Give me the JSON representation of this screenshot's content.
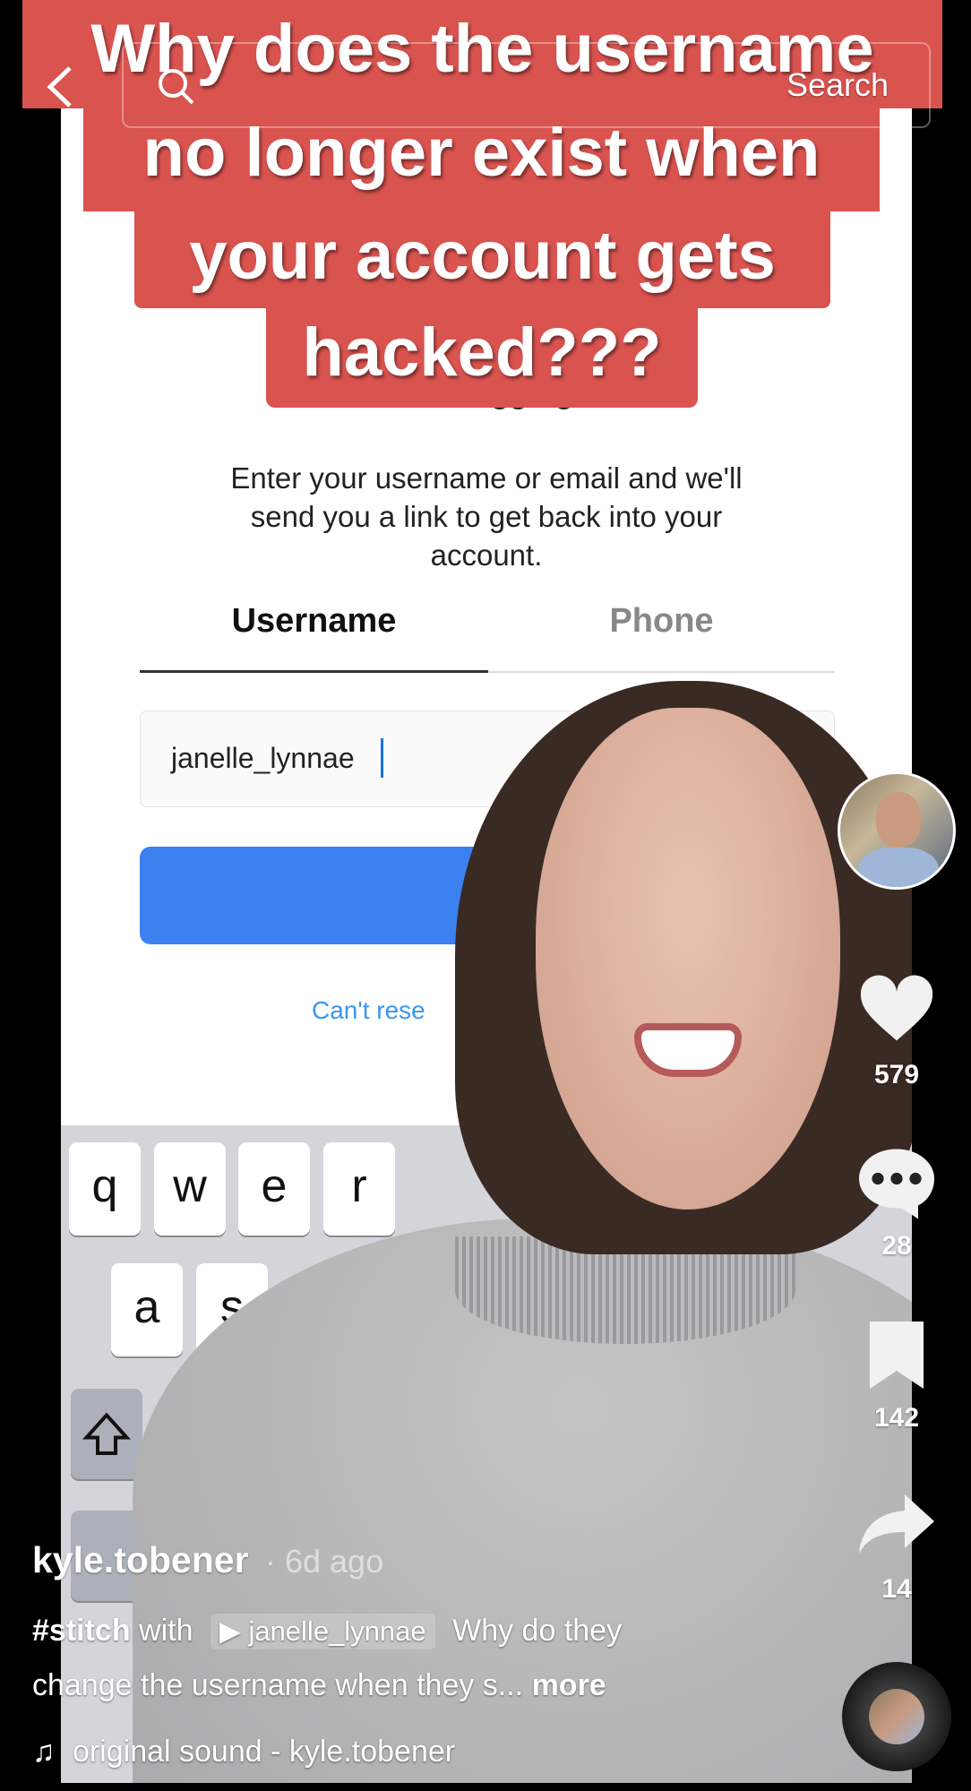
{
  "caption_lines": [
    "Why does the username",
    "no longer exist when",
    "your account gets",
    "hacked???"
  ],
  "search": {
    "button_label": "Search",
    "back_icon": "chevron-left-icon",
    "search_icon": "search-icon"
  },
  "screen": {
    "title_partial": "Trouble logging in?",
    "instructions": [
      "Enter your username or email and we'll",
      "send you a link to get back into your",
      "account."
    ],
    "tabs": [
      {
        "label": "Username",
        "active": true
      },
      {
        "label": "Phone",
        "active": false
      }
    ],
    "input_value": "janelle_lynnae",
    "link_partial": "Can't rese",
    "button_color": "#3b82f0",
    "keys_row1": [
      "q",
      "w",
      "e",
      "r"
    ],
    "keys_row2": [
      "a",
      "s"
    ],
    "shift_icon": "shift-icon"
  },
  "rail": {
    "likes": "579",
    "comments": "28",
    "saves": "142",
    "shares": "14"
  },
  "post": {
    "username": "kyle.tobener",
    "time": "· 6d ago",
    "hashtag": "#stitch",
    "with": "with",
    "stitch_user": "janelle_lynnae",
    "desc1": "Why do they",
    "desc2": "change the username when they s...",
    "more": "more",
    "sound": "original sound - kyle.tobener"
  },
  "colors": {
    "caption_bg": "#d9534f",
    "link": "#3897f0"
  }
}
